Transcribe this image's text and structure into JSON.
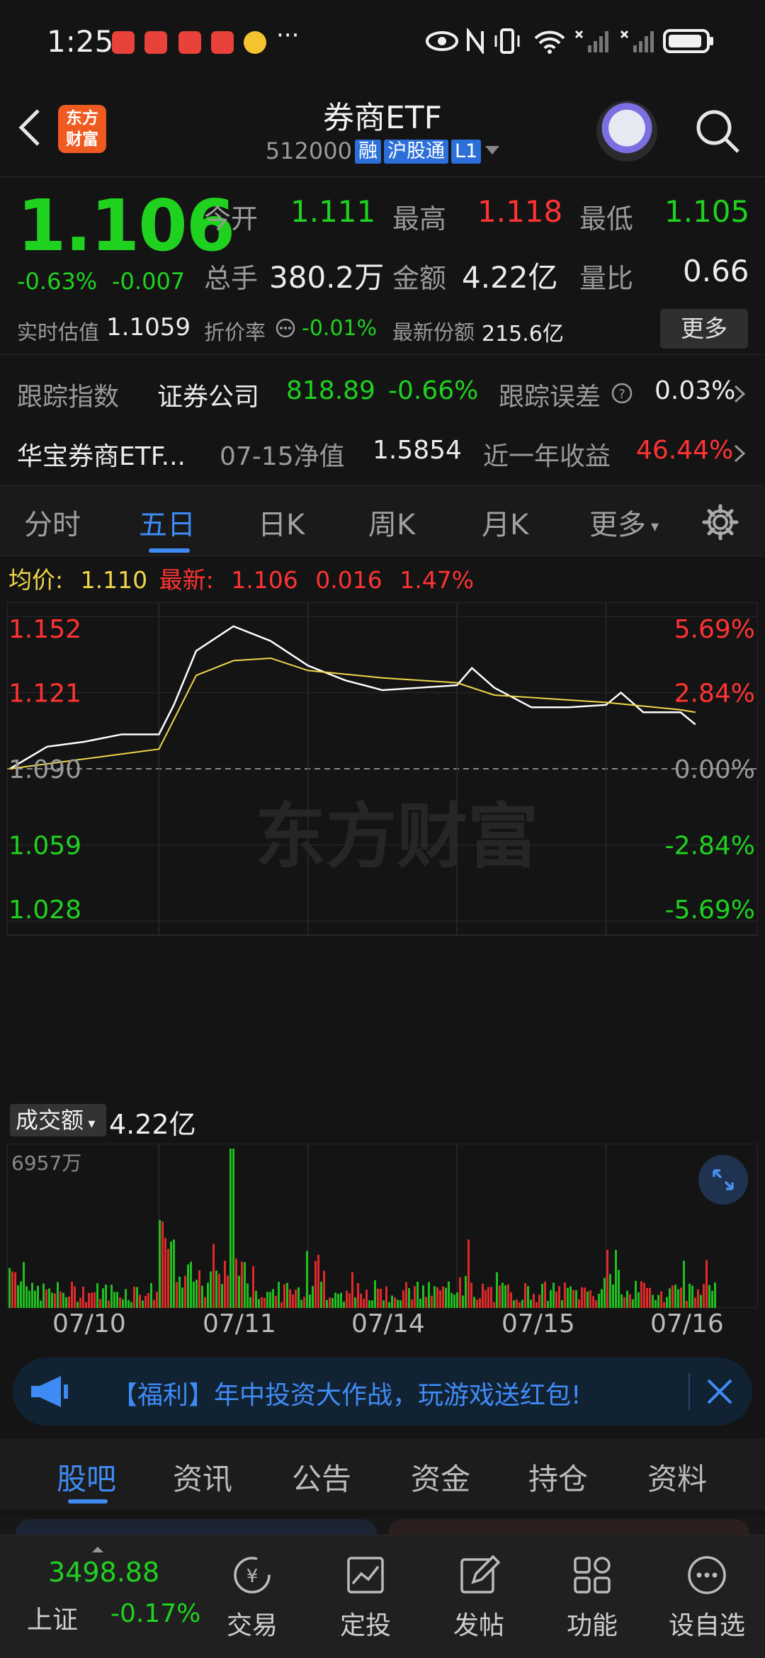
{
  "status_bar": {
    "time": "1:25",
    "more": "···"
  },
  "header": {
    "title": "券商ETF",
    "code": "512000",
    "tags": [
      "融",
      "沪股通",
      "L1"
    ],
    "logo_text_1": "东方",
    "logo_text_2": "财富"
  },
  "quote": {
    "price": "1.106",
    "change_pct": "-0.63%",
    "change": "-0.007",
    "open_label": "今开",
    "open": "1.111",
    "high_label": "最高",
    "high": "1.118",
    "low_label": "最低",
    "low": "1.105",
    "volume_label": "总手",
    "volume": "380.2万",
    "amount_label": "金额",
    "amount": "4.22亿",
    "ratio_label": "量比",
    "ratio": "0.66",
    "iopv_label": "实时估值",
    "iopv": "1.1059",
    "discount_label": "折价率",
    "discount": "-0.01%",
    "shares_label": "最新份额",
    "shares": "215.6亿",
    "more_button": "更多"
  },
  "tracking": {
    "index_label": "跟踪指数",
    "index_name": "证券公司",
    "index_value": "818.89",
    "index_change": "-0.66%",
    "error_label": "跟踪误差",
    "error_value": "0.03%",
    "fund_name": "华宝券商ETF...",
    "nav_label": "07-15净值",
    "nav_value": "1.5854",
    "year_label": "近一年收益",
    "year_value": "46.44%"
  },
  "chart_tabs": [
    "分时",
    "五日",
    "日K",
    "周K",
    "月K",
    "更多"
  ],
  "chart_info": {
    "avg_label": "均价:",
    "avg_value": "1.110",
    "latest_label": "最新:",
    "latest_value": "1.106",
    "latest_change": "0.016",
    "latest_pct": "1.47%"
  },
  "volume_panel": {
    "selector": "成交额",
    "total": "4.22亿",
    "max_label": "6957万"
  },
  "watermark": "东方财富",
  "banner": {
    "text": "【福利】年中投资大作战，玩游戏送红包!"
  },
  "bottom_tabs": [
    "股吧",
    "资讯",
    "公告",
    "资金",
    "持仓",
    "资料"
  ],
  "bottom_nav": {
    "index_value": "3498.88",
    "index_name": "上证",
    "index_change": "-0.17%",
    "items": [
      "交易",
      "定投",
      "发帖",
      "功能",
      "设自选"
    ]
  },
  "colors": {
    "up": "#ff3333",
    "down": "#1fd21f",
    "accent": "#3f8bf5",
    "avg_line": "#f0d64a",
    "price_line": "#ffffff"
  },
  "chart_data": {
    "type": "line",
    "title": "五日",
    "x_labels": [
      "07/10",
      "07/11",
      "07/14",
      "07/15",
      "07/16"
    ],
    "y_ticks": [
      "1.152",
      "1.121",
      "1.090",
      "1.059",
      "1.028"
    ],
    "pct_ticks": [
      "5.69%",
      "2.84%",
      "0.00%",
      "-2.84%",
      "-5.69%"
    ],
    "ylim": [
      1.028,
      1.152
    ],
    "prev_close": 1.09,
    "series": [
      {
        "name": "price",
        "x": [
          0,
          0.25,
          0.5,
          0.75,
          1,
          1.1,
          1.25,
          1.5,
          1.75,
          2,
          2.25,
          2.5,
          2.75,
          3,
          3.1,
          3.25,
          3.5,
          3.75,
          4,
          4.1,
          4.25,
          4.5,
          4.6
        ],
        "values": [
          1.09,
          1.099,
          1.101,
          1.104,
          1.104,
          1.116,
          1.138,
          1.148,
          1.142,
          1.132,
          1.126,
          1.122,
          1.123,
          1.124,
          1.131,
          1.123,
          1.115,
          1.115,
          1.116,
          1.121,
          1.113,
          1.113,
          1.108
        ]
      },
      {
        "name": "avg",
        "x": [
          0,
          0.5,
          1,
          1.1,
          1.25,
          1.5,
          1.75,
          2,
          2.5,
          3,
          3.25,
          3.5,
          4,
          4.5,
          4.6
        ],
        "values": [
          1.09,
          1.094,
          1.098,
          1.11,
          1.128,
          1.134,
          1.135,
          1.13,
          1.127,
          1.125,
          1.12,
          1.119,
          1.117,
          1.114,
          1.113
        ]
      }
    ],
    "volume_max": "6957万"
  }
}
